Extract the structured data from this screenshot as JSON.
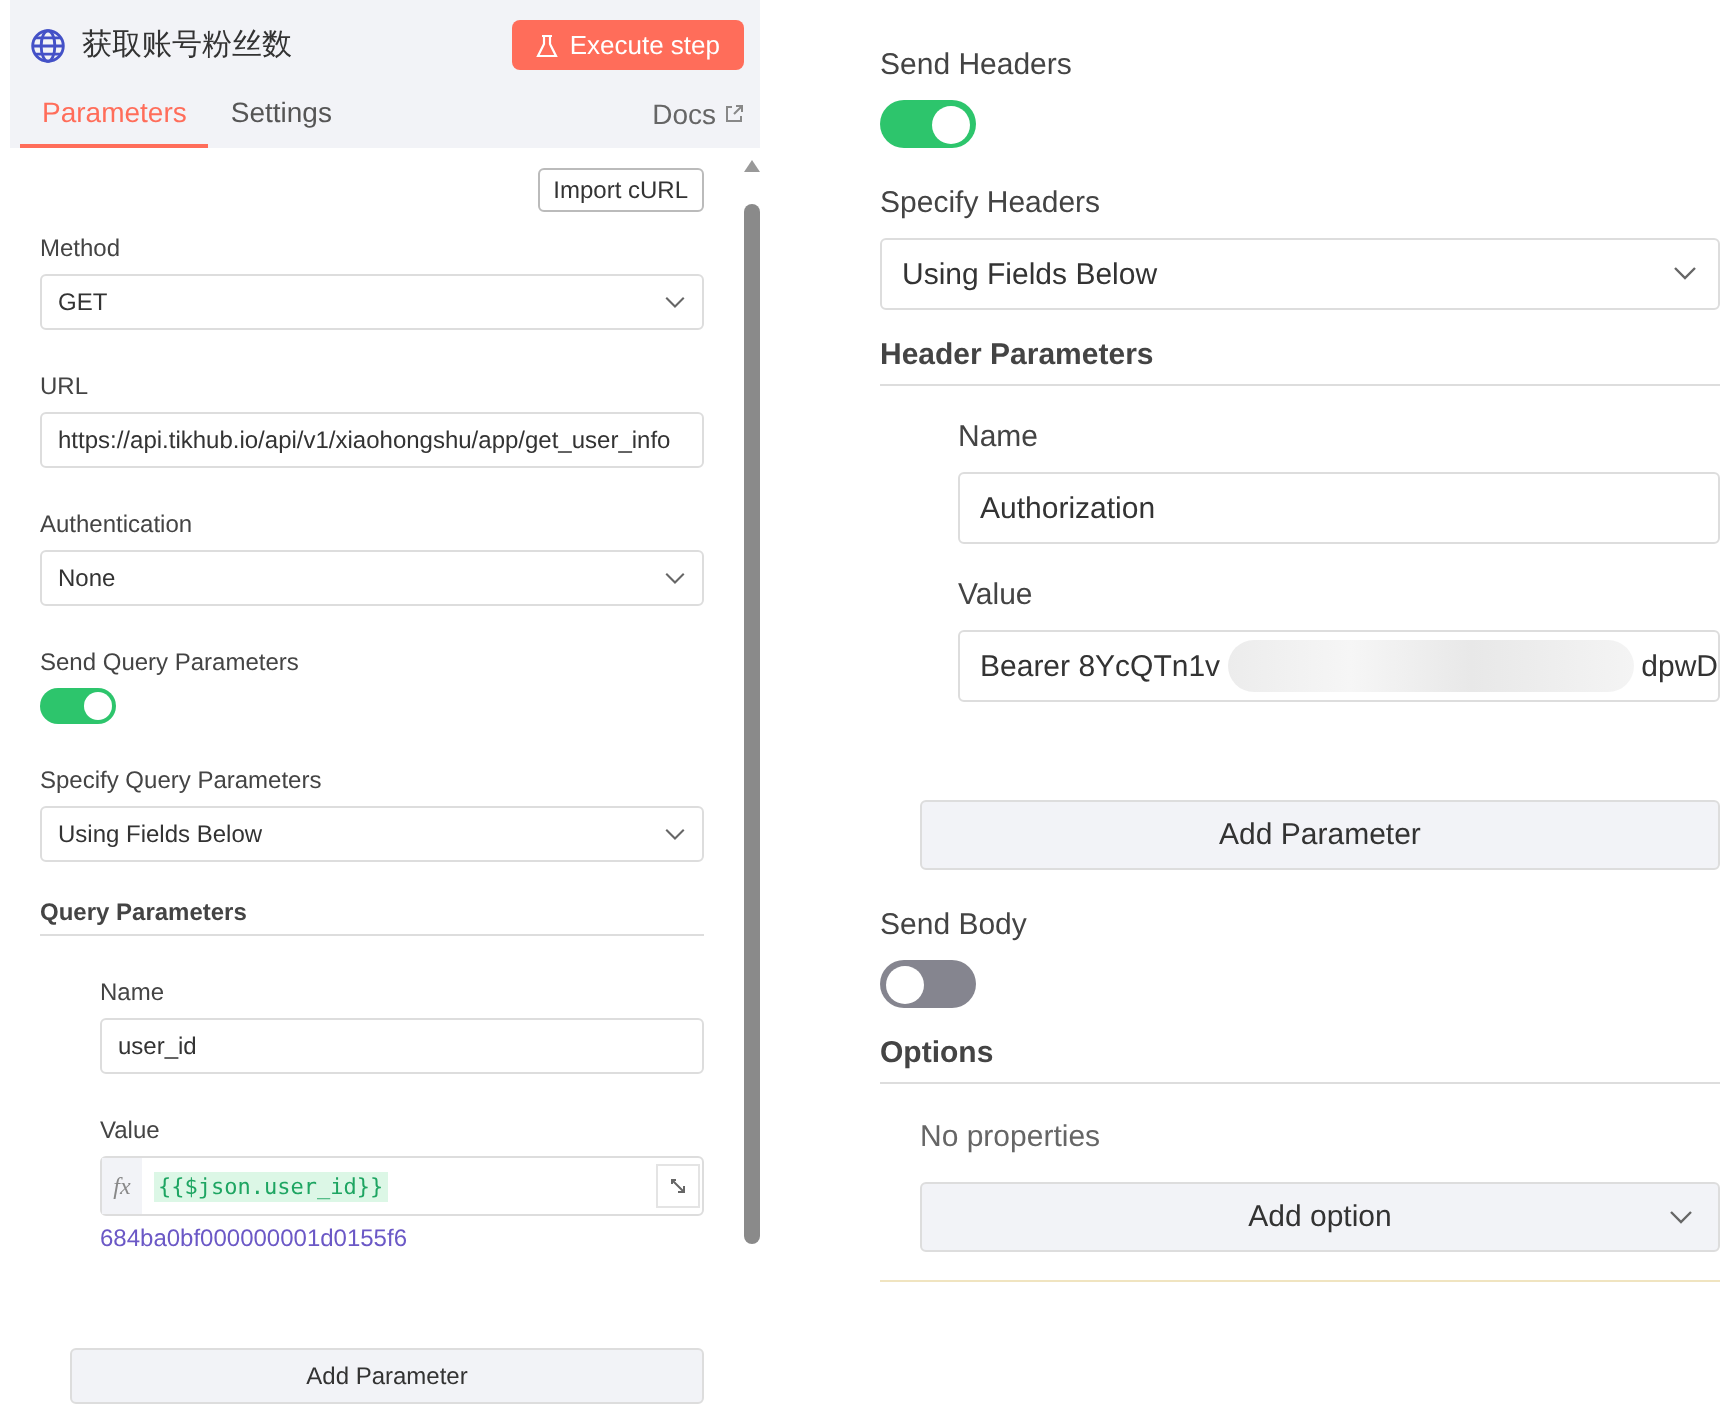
{
  "node": {
    "title": "获取账号粉丝数",
    "execute_button": "Execute step",
    "tabs": [
      {
        "label": "Parameters",
        "selected": true
      },
      {
        "label": "Settings",
        "selected": false
      }
    ],
    "docs_link": "Docs"
  },
  "left": {
    "import_button": "Import cURL",
    "fields": [
      {
        "kind": "select",
        "label": "Method",
        "value": "GET"
      },
      {
        "kind": "text",
        "label": "URL",
        "value": "https://api.tikhub.io/api/v1/xiaohongshu/app/get_user_info"
      },
      {
        "kind": "select",
        "label": "Authentication",
        "value": "None"
      },
      {
        "kind": "toggle",
        "label": "Send Query Parameters",
        "on": true
      },
      {
        "kind": "select",
        "label": "Specify Query Parameters",
        "value": "Using Fields Below"
      }
    ],
    "section": {
      "title": "Query Parameters",
      "name_label": "Name",
      "name_value": "user_id",
      "value_label": "Value",
      "fx": "fx",
      "expression": "{{$json.user_id}}",
      "resolved": "684ba0bf000000001d0155f6",
      "add_button": "Add Parameter"
    }
  },
  "right": {
    "fields": [
      {
        "kind": "toggle",
        "label": "Send Headers",
        "on": true
      },
      {
        "kind": "select",
        "label": "Specify Headers",
        "value": "Using Fields Below"
      }
    ],
    "section": {
      "title": "Header Parameters",
      "name_label": "Name",
      "name_value": "Authorization",
      "value_label": "Value",
      "value_start": "Bearer 8YcQTn1v",
      "value_end": "dpwD",
      "add_button": "Add Parameter"
    },
    "send_body": {
      "label": "Send Body",
      "on": false
    },
    "options": {
      "title": "Options",
      "empty": "No properties",
      "add_button": "Add option"
    }
  }
}
